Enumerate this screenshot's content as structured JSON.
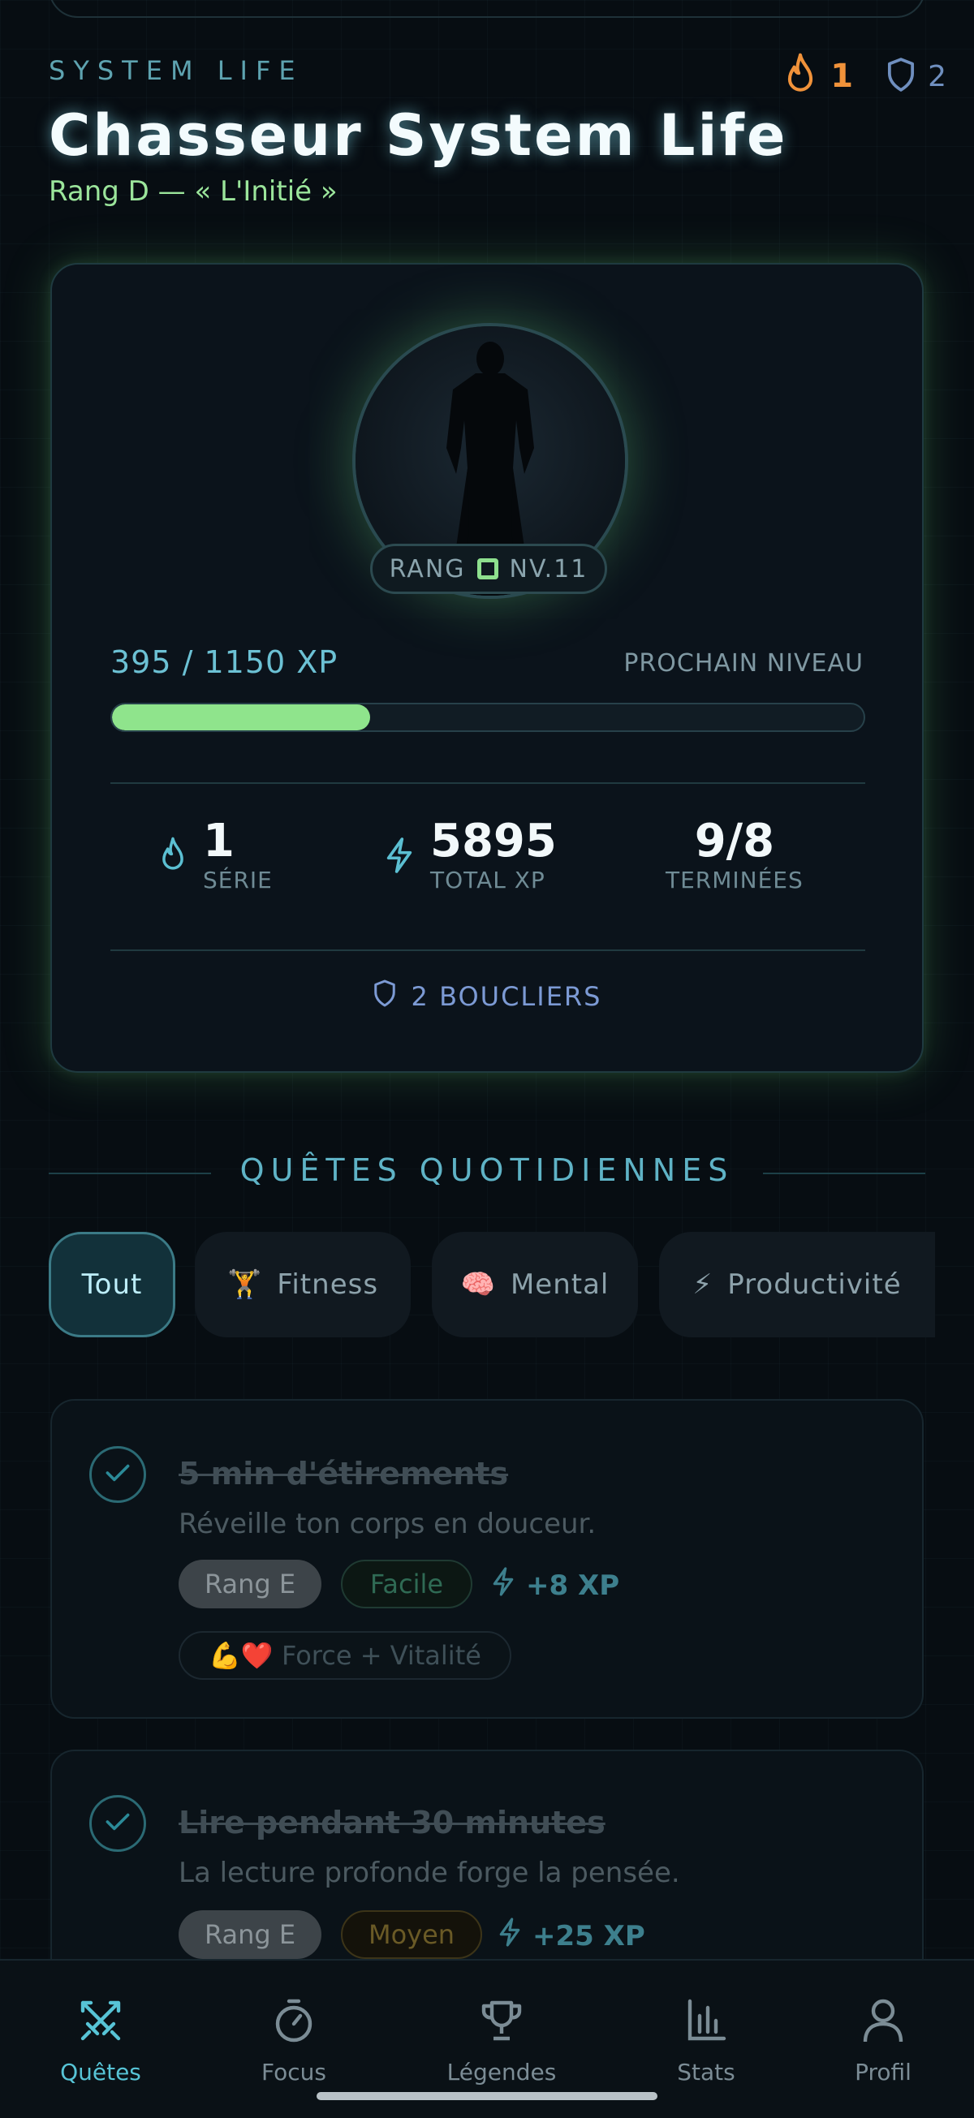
{
  "header": {
    "eyebrow": "SYSTEM LIFE",
    "title": "Chasseur System Life",
    "subtitle": "Rang D — « L'Initié »",
    "streak_count": "1",
    "shield_count": "2"
  },
  "profile_card": {
    "rank_label": "RANG",
    "level_label": "NV.11",
    "xp_text": "395 / 1150 XP",
    "next_level_label": "PROCHAIN NIVEAU",
    "xp_current": 395,
    "xp_target": 1150,
    "stats": [
      {
        "value": "1",
        "label": "SÉRIE",
        "icon": "flame-icon"
      },
      {
        "value": "5895",
        "label": "TOTAL XP",
        "icon": "bolt-icon"
      },
      {
        "value": "9/8",
        "label": "TERMINÉES",
        "icon": ""
      }
    ],
    "shields_text": "2 BOUCLIERS"
  },
  "section": {
    "title": "QUÊTES QUOTIDIENNES"
  },
  "filters": [
    {
      "label": "Tout",
      "emoji": "",
      "active": true
    },
    {
      "label": "Fitness",
      "emoji": "🏋️",
      "active": false
    },
    {
      "label": "Mental",
      "emoji": "🧠",
      "active": false
    },
    {
      "label": "Productivité",
      "emoji": "⚡",
      "active": false
    }
  ],
  "quests": [
    {
      "title": "5 min d'étirements",
      "description": "Réveille ton corps en douceur.",
      "rank": "Rang E",
      "difficulty": "Facile",
      "xp": "+8 XP",
      "category": "💪❤️ Force + Vitalité"
    },
    {
      "title": "Lire pendant 30 minutes",
      "description": "La lecture profonde forge la pensée.",
      "rank": "Rang E",
      "difficulty": "Moyen",
      "xp": "+25 XP"
    }
  ],
  "tabbar": [
    {
      "label": "Quêtes",
      "icon": "swords-icon",
      "active": true
    },
    {
      "label": "Focus",
      "icon": "stopwatch-icon",
      "active": false
    },
    {
      "label": "Légendes",
      "icon": "trophy-icon",
      "active": false
    },
    {
      "label": "Stats",
      "icon": "bar-chart-icon",
      "active": false
    },
    {
      "label": "Profil",
      "icon": "user-icon",
      "active": false
    }
  ],
  "colors": {
    "background": "#070d12",
    "accent_cyan": "#57c4d6",
    "accent_green": "#8fe48c",
    "streak_orange": "#f0923a",
    "shield_blue": "#6f8fbf"
  }
}
